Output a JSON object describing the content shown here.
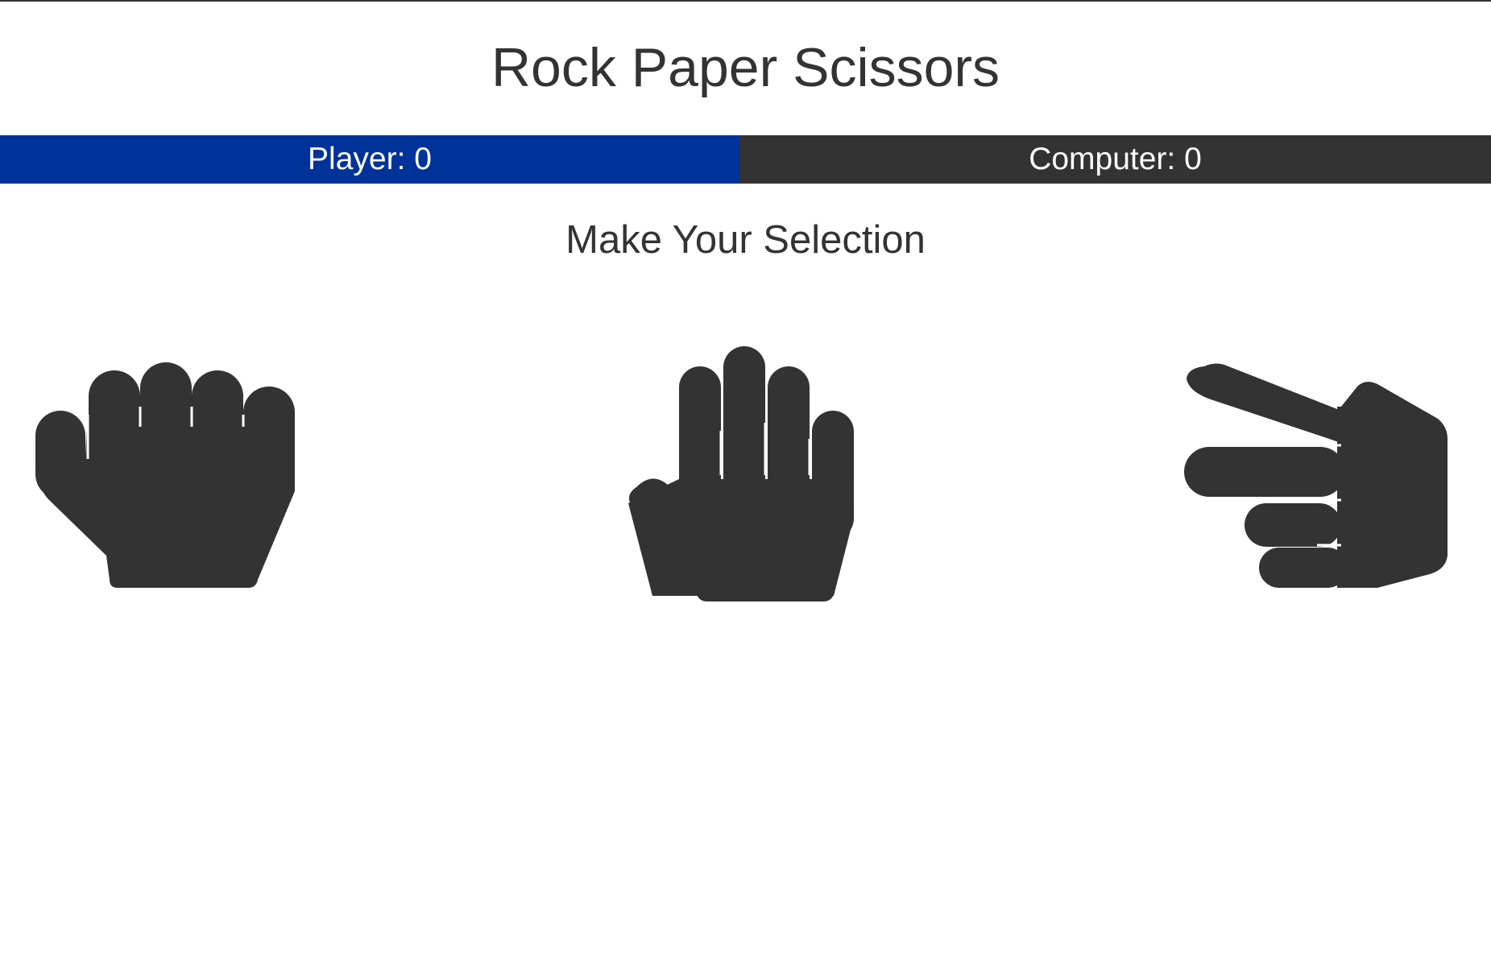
{
  "app": {
    "title": "Rock Paper Scissors",
    "subtitle": "Make Your Selection"
  },
  "scoreboard": {
    "player_label": "Player: 0",
    "computer_label": "Computer: 0",
    "player_color": "#003399",
    "computer_color": "#333333"
  },
  "choices": [
    {
      "name": "rock",
      "icon": "hand-rock-icon"
    },
    {
      "name": "paper",
      "icon": "hand-paper-icon"
    },
    {
      "name": "scissors",
      "icon": "hand-scissors-icon"
    }
  ],
  "colors": {
    "text": "#333333",
    "icon": "#333333",
    "background": "#ffffff"
  }
}
